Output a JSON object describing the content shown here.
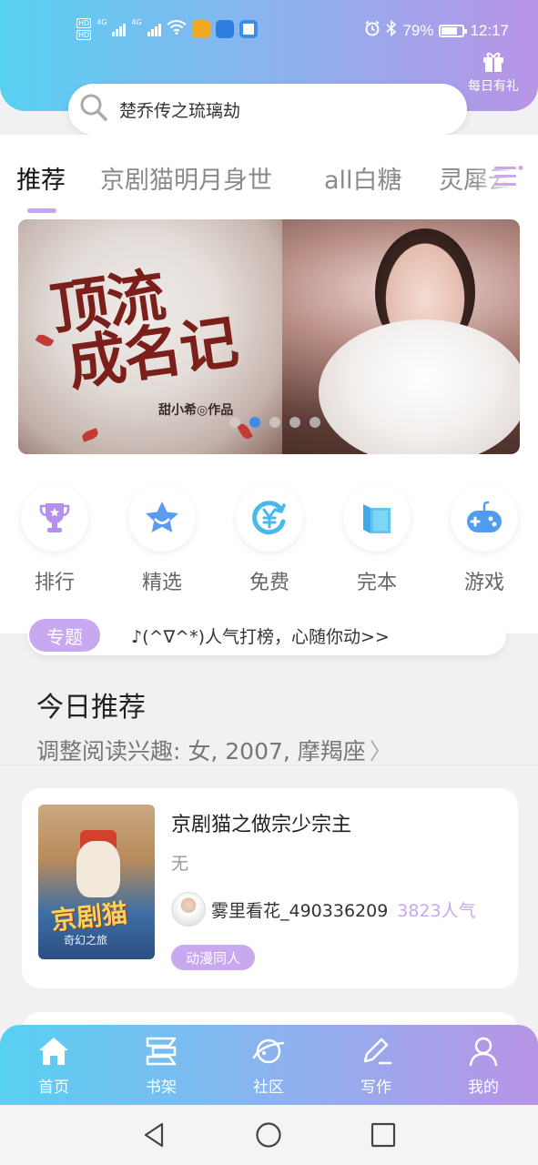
{
  "status_bar": {
    "net1": "4G",
    "net2": "4G",
    "battery": "79%",
    "battery_level": 0.79,
    "time": "12:17"
  },
  "header": {
    "gift_label": "每日有礼"
  },
  "search": {
    "placeholder": "楚乔传之琉璃劫"
  },
  "tabs": [
    {
      "label": "推荐",
      "active": true
    },
    {
      "label": "京剧猫明月身世",
      "active": false
    },
    {
      "label": "all白糖",
      "active": false
    },
    {
      "label": "灵犀云",
      "active": false
    }
  ],
  "banner": {
    "title_line1": "顶流",
    "title_line2": "成名记",
    "author": "甜小希◎作品",
    "slide_count": 5,
    "active_slide": 1
  },
  "quick_nav": [
    {
      "label": "排行",
      "icon": "trophy-icon"
    },
    {
      "label": "精选",
      "icon": "star-icon"
    },
    {
      "label": "免费",
      "icon": "yen-coin-icon"
    },
    {
      "label": "完本",
      "icon": "book-icon"
    },
    {
      "label": "游戏",
      "icon": "gamepad-icon"
    }
  ],
  "topic": {
    "badge": "专题",
    "text": "♪(^∇^*)人气打榜，心随你动>>"
  },
  "recommend": {
    "title": "今日推荐",
    "subtitle": "调整阅读兴趣: 女, 2007, 摩羯座",
    "chevron": "〉"
  },
  "book": {
    "title": "京剧猫之做宗少宗主",
    "description": "无",
    "author": "雾里看花_490336209",
    "popularity": "3823人气",
    "tag": "动漫同人",
    "cover_logo": "京剧猫",
    "cover_tagline": "奇幻之旅"
  },
  "bottom_nav": [
    {
      "label": "首页",
      "icon": "home-icon"
    },
    {
      "label": "书架",
      "icon": "bookshelf-icon"
    },
    {
      "label": "社区",
      "icon": "planet-icon"
    },
    {
      "label": "写作",
      "icon": "pen-icon"
    },
    {
      "label": "我的",
      "icon": "user-icon"
    }
  ],
  "colors": {
    "accent_purple": "#c8a8ee",
    "gradient_start": "#58d0f2",
    "gradient_end": "#b894e6",
    "dot_active": "#3d8de8"
  }
}
